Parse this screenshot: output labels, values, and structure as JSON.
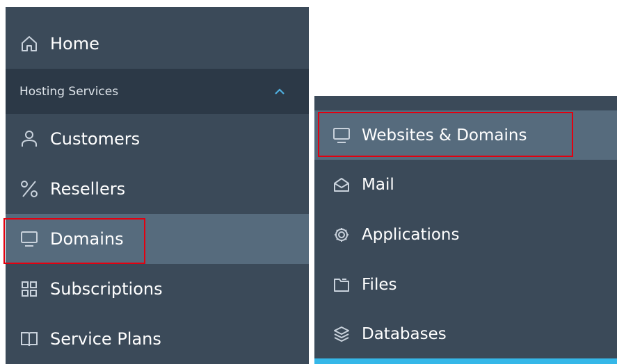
{
  "left_nav": {
    "home": "Home",
    "section": "Hosting Services",
    "items": [
      {
        "label": "Customers",
        "icon": "user-icon"
      },
      {
        "label": "Resellers",
        "icon": "percent-icon"
      },
      {
        "label": "Domains",
        "icon": "monitor-icon"
      },
      {
        "label": "Subscriptions",
        "icon": "grid-icon"
      },
      {
        "label": "Service Plans",
        "icon": "book-icon"
      }
    ],
    "active": "Domains"
  },
  "right_nav": {
    "items": [
      {
        "label": "Websites & Domains",
        "icon": "monitor-icon"
      },
      {
        "label": "Mail",
        "icon": "mail-icon"
      },
      {
        "label": "Applications",
        "icon": "gear-icon"
      },
      {
        "label": "Files",
        "icon": "folder-icon"
      },
      {
        "label": "Databases",
        "icon": "layers-icon"
      }
    ],
    "active": "Websites & Domains"
  },
  "colors": {
    "panel_bg": "#3b4a59",
    "section_bg": "#2c3947",
    "active_bg": "#566b7d",
    "highlight": "#e3000f",
    "accent": "#35b7e8"
  }
}
